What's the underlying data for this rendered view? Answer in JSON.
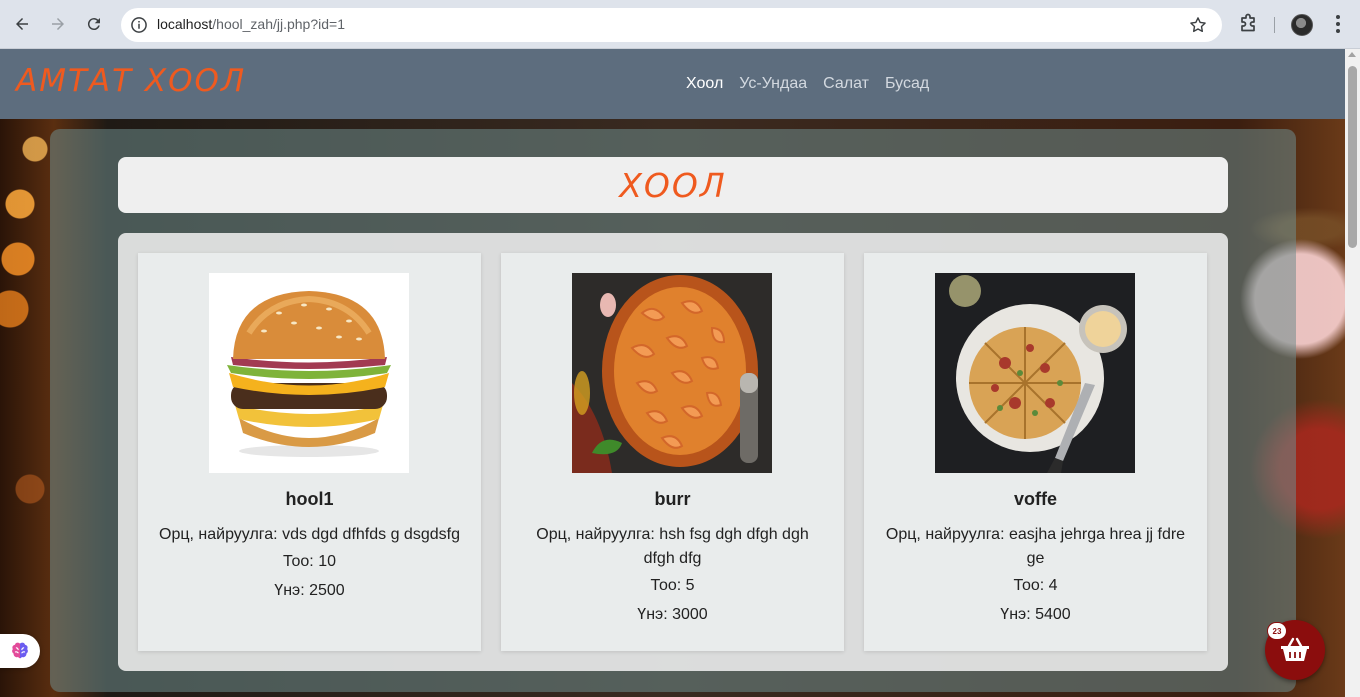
{
  "browser": {
    "url_host": "localhost",
    "url_path": "/hool_zah/jj.php?id=1"
  },
  "site": {
    "logo": "АМТАТ ХООЛ",
    "nav": [
      {
        "label": "Хоол",
        "active": true
      },
      {
        "label": "Ус-Ундаа",
        "active": false
      },
      {
        "label": "Салат",
        "active": false
      },
      {
        "label": "Бусад",
        "active": false
      }
    ]
  },
  "section": {
    "title": "ХООЛ"
  },
  "products": [
    {
      "name": "hool1",
      "description": "Орц, найруулга: vds dgd dfhfds g dsgdsfg",
      "quantity": "Тоо: 10",
      "price": "Үнэ: 2500",
      "image": "burger-photo"
    },
    {
      "name": "burr",
      "description": "Орц, найруулга: hsh fsg dgh dfgh dgh dfgh dfg",
      "quantity": "Тоо: 5",
      "price": "Үнэ: 3000",
      "image": "shrimp-dish-photo"
    },
    {
      "name": "voffe",
      "description": "Орц, найруулга: easjha jehrga hrea jj fdre ge",
      "quantity": "Тоо: 4",
      "price": "Үнэ: 5400",
      "image": "frittata-photo"
    }
  ],
  "cart": {
    "count": "23"
  },
  "colors": {
    "accent": "#ef5a1f",
    "topbar": "#5d6d7e",
    "cart": "#8b0d0d"
  }
}
